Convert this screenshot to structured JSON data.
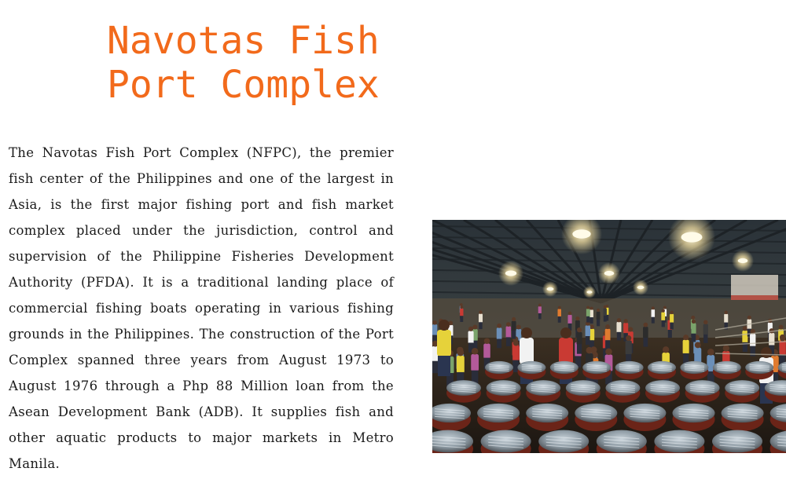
{
  "header": {
    "title_line1": "Navotas Fish",
    "title_line2": "Port Complex"
  },
  "article": {
    "body": "The Navotas Fish Port Complex (NFPC), the premier fish center of the Philippines and one of the largest in Asia, is the first major fishing port and fish market complex placed under the jurisdiction, control and supervision of the Philippine Fisheries Development Authority (PFDA). It is a traditional landing place of commercial fishing boats operating in various fishing grounds in the Philippines. The construction of the Port Complex spanned three years from August 1973 to August 1976 through a Php 88 Million loan from the Asean Development Bank (ADB). It supplies fish and other aquatic products to major markets in Metro Manila."
  },
  "colors": {
    "title": "#f26a1b",
    "text": "#1a1a1a"
  }
}
